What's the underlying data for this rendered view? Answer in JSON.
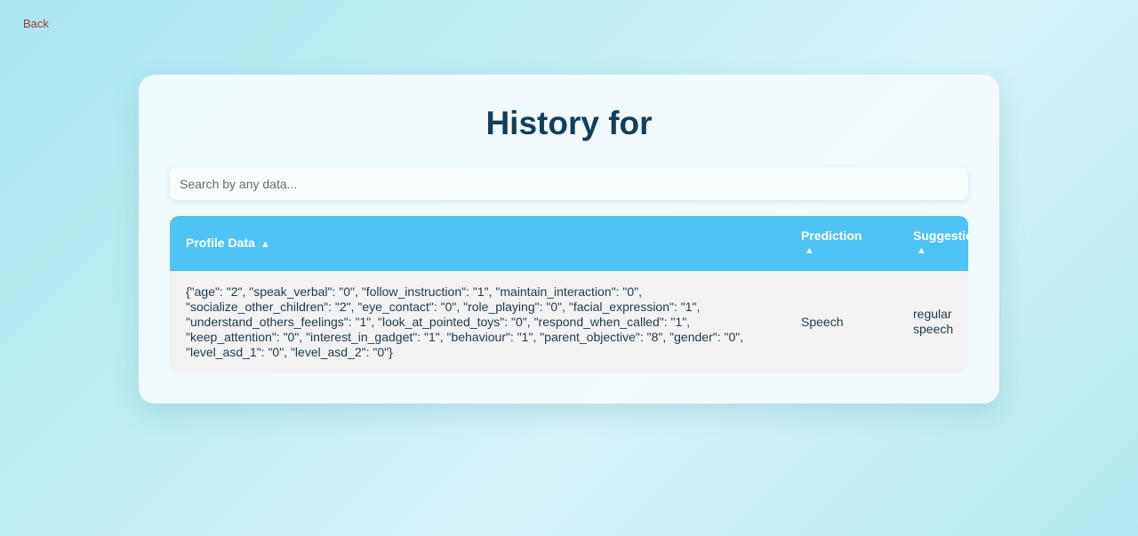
{
  "nav": {
    "back_label": "Back"
  },
  "page": {
    "title": "History for"
  },
  "search": {
    "placeholder": "Search by any data...",
    "value": ""
  },
  "table": {
    "headers": {
      "profile": "Profile Data",
      "prediction": "Prediction",
      "suggestion": "Suggestion",
      "sort_icon": "▲"
    },
    "rows": [
      {
        "profile": "{\"age\": \"2\", \"speak_verbal\": \"0\", \"follow_instruction\": \"1\", \"maintain_interaction\": \"0\", \"socialize_other_children\": \"2\", \"eye_contact\": \"0\", \"role_playing\": \"0\", \"facial_expression\": \"1\", \"understand_others_feelings\": \"1\", \"look_at_pointed_toys\": \"0\", \"respond_when_called\": \"1\", \"keep_attention\": \"0\", \"interest_in_gadget\": \"1\", \"behaviour\": \"1\", \"parent_objective\": \"8\", \"gender\": \"0\", \"level_asd_1\": \"0\", \"level_asd_2\": \"0\"}",
        "prediction": "Speech",
        "suggestion": "regular speech"
      }
    ]
  },
  "colors": {
    "header_bg": "#4fc3f3",
    "title": "#123e5a",
    "back_link": "#9b3b3b",
    "row_bg": "#f2f2f2"
  }
}
